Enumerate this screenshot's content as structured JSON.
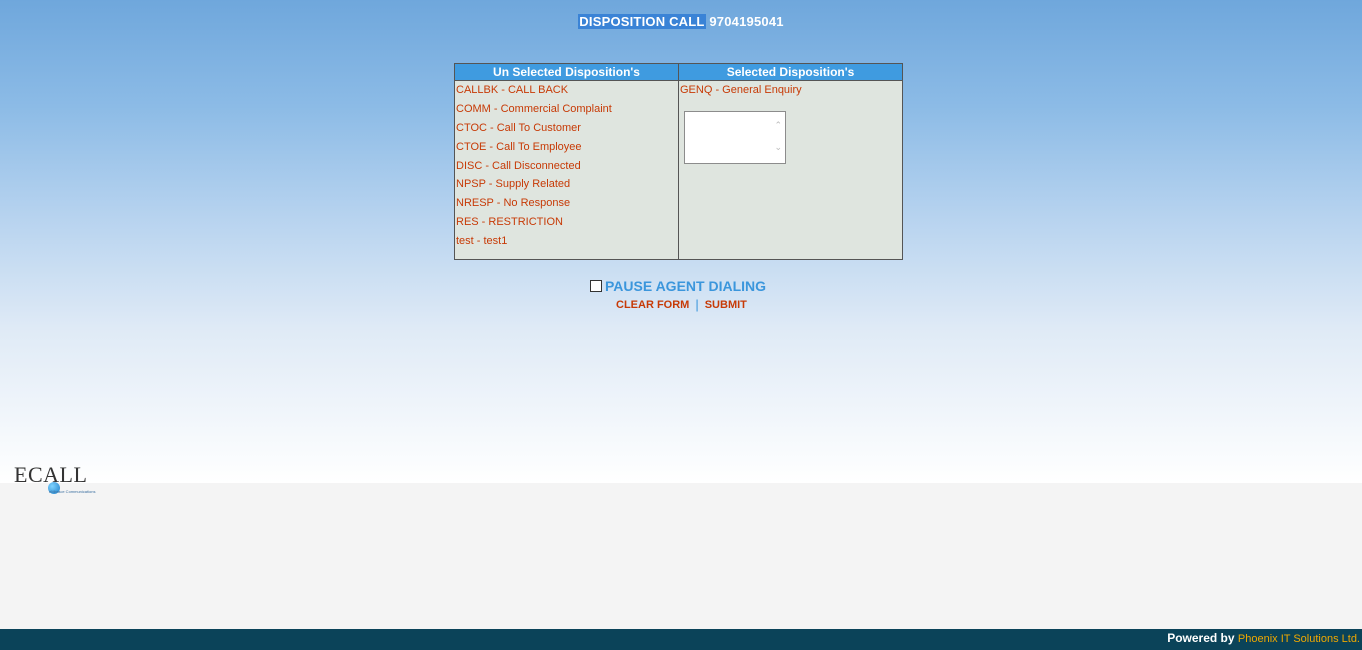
{
  "header": {
    "title_prefix": "DISPOSITION CALL",
    "phone": "9704195041"
  },
  "table": {
    "unselected_header": "Un Selected Disposition's",
    "selected_header": "Selected Disposition's",
    "unselected": [
      "CALLBK - CALL BACK",
      "COMM - Commercial Complaint",
      "CTOC - Call To Customer",
      "CTOE - Call To Employee",
      "DISC - Call Disconnected",
      "NPSP - Supply Related",
      "NRESP - No Response",
      "RES - RESTRICTION",
      "test - test1"
    ],
    "selected": [
      "GENQ - General Enquiry"
    ]
  },
  "controls": {
    "pause_label": "PAUSE AGENT DIALING",
    "clear_label": "CLEAR FORM",
    "separator": "|",
    "submit_label": "SUBMIT"
  },
  "logo": {
    "text": "ECALL",
    "tagline": "eMbrace Communications"
  },
  "footer": {
    "powered_by": "Powered by",
    "company": "Phoenix IT Solutions Ltd."
  },
  "colors": {
    "accent": "#3f9be0",
    "item_text": "#c73a06",
    "footer_bg": "#0b4359",
    "footer_company": "#f0a800"
  }
}
